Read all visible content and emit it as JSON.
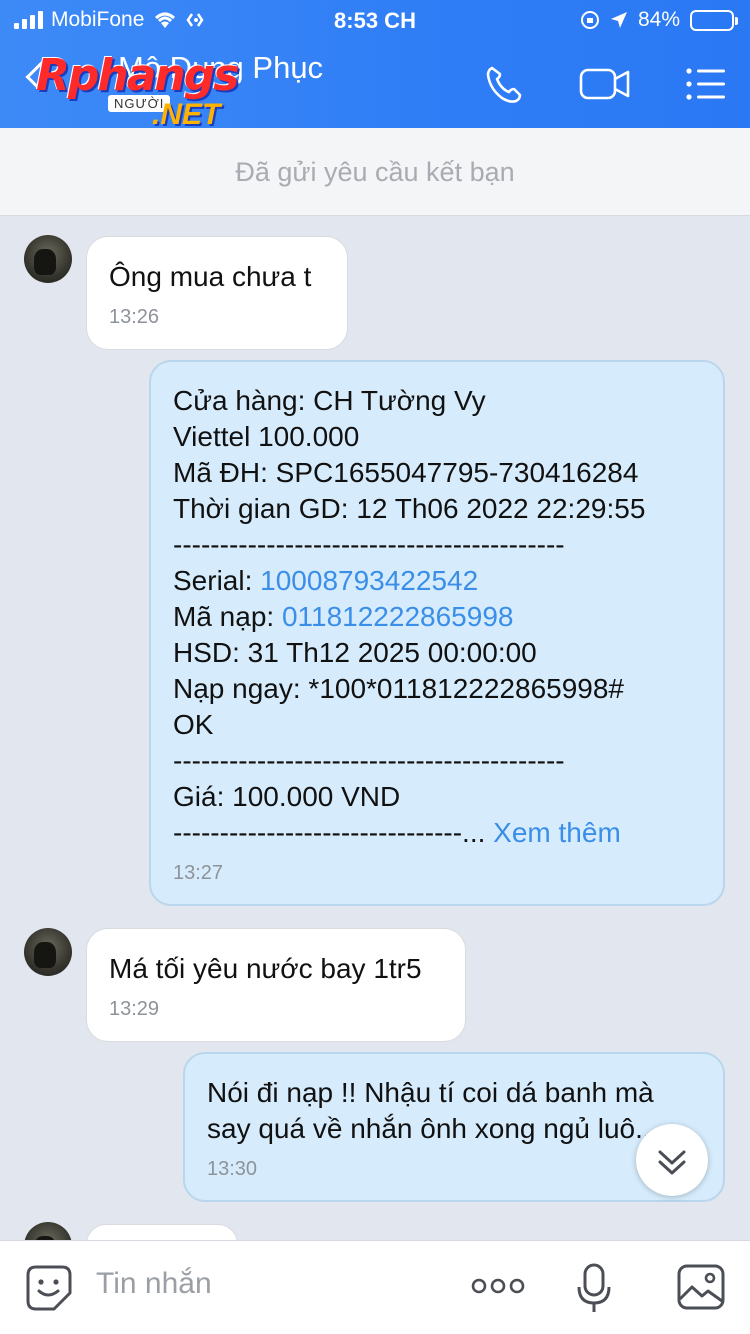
{
  "status_bar": {
    "carrier": "MobiFone",
    "time": "8:53 CH",
    "battery": "84%",
    "battery_level": 0.84
  },
  "header": {
    "contact_name": "Mộ Dung Phục",
    "watermark_main": "Rphangs",
    "watermark_sub": "NGƯỜI",
    "watermark_domain": ".NET"
  },
  "banner": {
    "text": "Đã gửi yêu cầu kết bạn"
  },
  "messages": [
    {
      "direction": "in",
      "text": "Ông mua chưa t",
      "time": "13:26"
    },
    {
      "direction": "out",
      "lines": {
        "store": "Cửa hàng: CH Tường Vy",
        "product": "Viettel 100.000",
        "order": "Mã ĐH: SPC1655047795-730416284",
        "txn_time": "Thời gian GD: 12 Th06 2022 22:29:55",
        "divider": "------------------------------------------",
        "serial_label": "Serial: ",
        "serial_value": "10008793422542",
        "code_label": "Mã nạp: ",
        "code_value": "011812222865998",
        "expiry": "HSD: 31 Th12 2025 00:00:00",
        "topup": "Nạp ngay: *100*011812222865998#",
        "ok": "OK",
        "price": "Giá: 100.000 VND",
        "divider_short": "-------------------------------... ",
        "see_more": "Xem thêm"
      },
      "time": "13:27"
    },
    {
      "direction": "in",
      "text": "Má tối yêu nước bay 1tr5",
      "time": "13:29"
    },
    {
      "direction": "out",
      "line1": "Nói đi nạp !! Nhậu tí coi dá banh mà",
      "line2": "say quá về nhắn ônh xong ngủ luô...",
      "time": "13:30"
    }
  ],
  "input_bar": {
    "placeholder": "Tin nhắn"
  }
}
